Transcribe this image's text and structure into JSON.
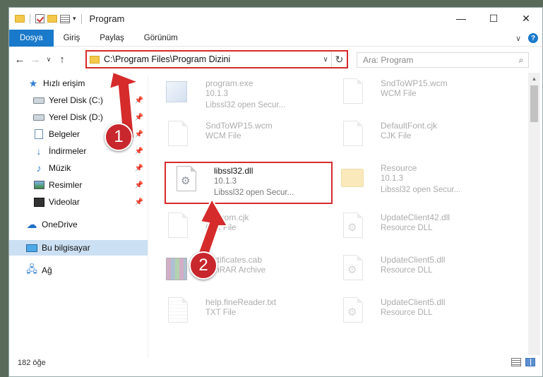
{
  "window": {
    "title": "Program",
    "controls": {
      "minimize": "—",
      "maximize": "☐",
      "close": "✕"
    }
  },
  "ribbon": {
    "tabs": [
      "Dosya",
      "Giriş",
      "Paylaş",
      "Görünüm"
    ],
    "active_tab": "Dosya"
  },
  "nav": {
    "back": "←",
    "forward": "→",
    "recent": "∨",
    "up": "↑",
    "address": "C:\\Program Files\\Program Dizini",
    "search_placeholder": "Ara: Program"
  },
  "sidebar": {
    "items": [
      {
        "label": "Hızlı erişim",
        "icon": "quick-access-star-icon"
      },
      {
        "label": "Yerel Disk (C:)",
        "icon": "drive-icon",
        "pinned": true
      },
      {
        "label": "Yerel Disk (D:)",
        "icon": "drive-icon",
        "pinned": true
      },
      {
        "label": "Belgeler",
        "icon": "documents-icon",
        "pinned": true
      },
      {
        "label": "İndirmeler",
        "icon": "downloads-icon",
        "pinned": true
      },
      {
        "label": "Müzik",
        "icon": "music-icon",
        "pinned": true
      },
      {
        "label": "Resimler",
        "icon": "pictures-icon",
        "pinned": true
      },
      {
        "label": "Videolar",
        "icon": "videos-icon",
        "pinned": true
      },
      {
        "label": "OneDrive",
        "icon": "onedrive-icon"
      },
      {
        "label": "Bu bilgisayar",
        "icon": "this-pc-icon",
        "selected": true
      },
      {
        "label": "Ağ",
        "icon": "network-icon"
      }
    ]
  },
  "files": [
    {
      "name": "program.exe",
      "line2": "10.1.3",
      "line3": "Libssl32 open Secur...",
      "icon": "exe-icon"
    },
    {
      "name": "SndToWP15.wcm",
      "line2": "WCM File",
      "line3": "",
      "icon": "file-icon"
    },
    {
      "name": "SndToWP15.wcm",
      "line2": "WCM File",
      "line3": "",
      "icon": "file-icon"
    },
    {
      "name": "DefaultFont.cjk",
      "line2": "CJK File",
      "line3": "",
      "icon": "file-icon"
    },
    {
      "name": "libssl32.dll",
      "line2": "10.1.3",
      "line3": "Libssl32 open Secur...",
      "icon": "dll-icon"
    },
    {
      "name": "Resource",
      "line2": "10.1.3",
      "line3": "Libssl32 open Secur...",
      "icon": "folder-icon"
    },
    {
      "name": "Liberom.cjk",
      "line2": "CJK File",
      "line3": "",
      "icon": "file-icon"
    },
    {
      "name": "UpdateClient42.dll",
      "line2": "Resource DLL",
      "line3": "",
      "icon": "dll-icon"
    },
    {
      "name": "certificates.cab",
      "line2": "WinRAR Archive",
      "line3": "",
      "icon": "rar-icon"
    },
    {
      "name": "UpdateClient5.dll",
      "line2": "Resource DLL",
      "line3": "",
      "icon": "dll-icon"
    },
    {
      "name": "help.fineReader.txt",
      "line2": "TXT File",
      "line3": "",
      "icon": "txt-icon"
    },
    {
      "name": "UpdateClient5.dll",
      "line2": "Resource DLL",
      "line3": "",
      "icon": "dll-icon"
    }
  ],
  "status": {
    "count": "182 öğe"
  },
  "annotations": {
    "badge1": "1",
    "badge2": "2"
  },
  "colors": {
    "accent": "#1979ca",
    "highlight": "#d62b2b",
    "badge": "#c8272d",
    "selected": "#cce0f3"
  }
}
